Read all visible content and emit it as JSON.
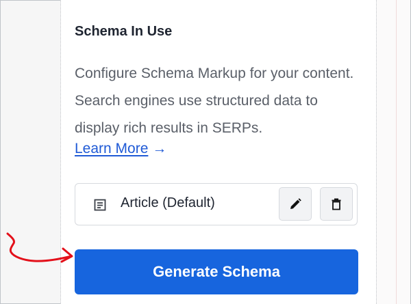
{
  "panel": {
    "title": "Schema In Use",
    "description": "Configure Schema Markup for your content. Search engines use structured data to display rich results in SERPs.",
    "learn_more": "Learn More",
    "learn_more_arrow": "→"
  },
  "schema_list": {
    "items": [
      {
        "label": "Article (Default)",
        "icon": "document-icon"
      }
    ]
  },
  "actions": {
    "generate_label": "Generate Schema"
  },
  "icons": {
    "edit": "pencil-icon",
    "delete": "trash-icon",
    "annotation": "red-hand-drawn-arrow"
  },
  "colors": {
    "accent": "#1765de",
    "link": "#1f5ad6",
    "annotation": "#e3101a"
  }
}
